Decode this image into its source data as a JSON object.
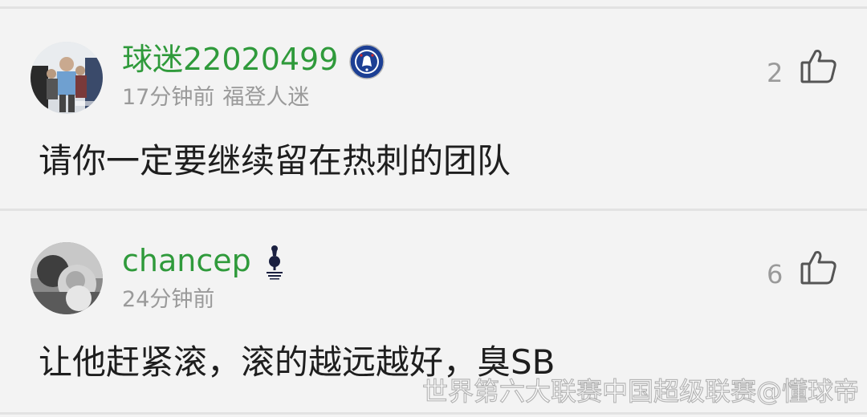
{
  "comments": [
    {
      "username": "球迷22020499",
      "team_badge": "chelsea-badge-icon",
      "time": "17分钟前",
      "fan_tag": "福登人迷",
      "like_count": "2",
      "text": "请你一定要继续留在热刺的团队"
    },
    {
      "username": "chancep",
      "team_badge": "tottenham-badge-icon",
      "time": "24分钟前",
      "fan_tag": "",
      "like_count": "6",
      "text": "让他赶紧滚，滚的越远越好，臭SB"
    }
  ],
  "watermark": "世界第六大联赛中国超级联赛@懂球帝",
  "colors": {
    "username": "#2f9a3b",
    "meta": "#9a9a9a",
    "text": "#1e1e1e",
    "background": "#f3f3f3"
  }
}
